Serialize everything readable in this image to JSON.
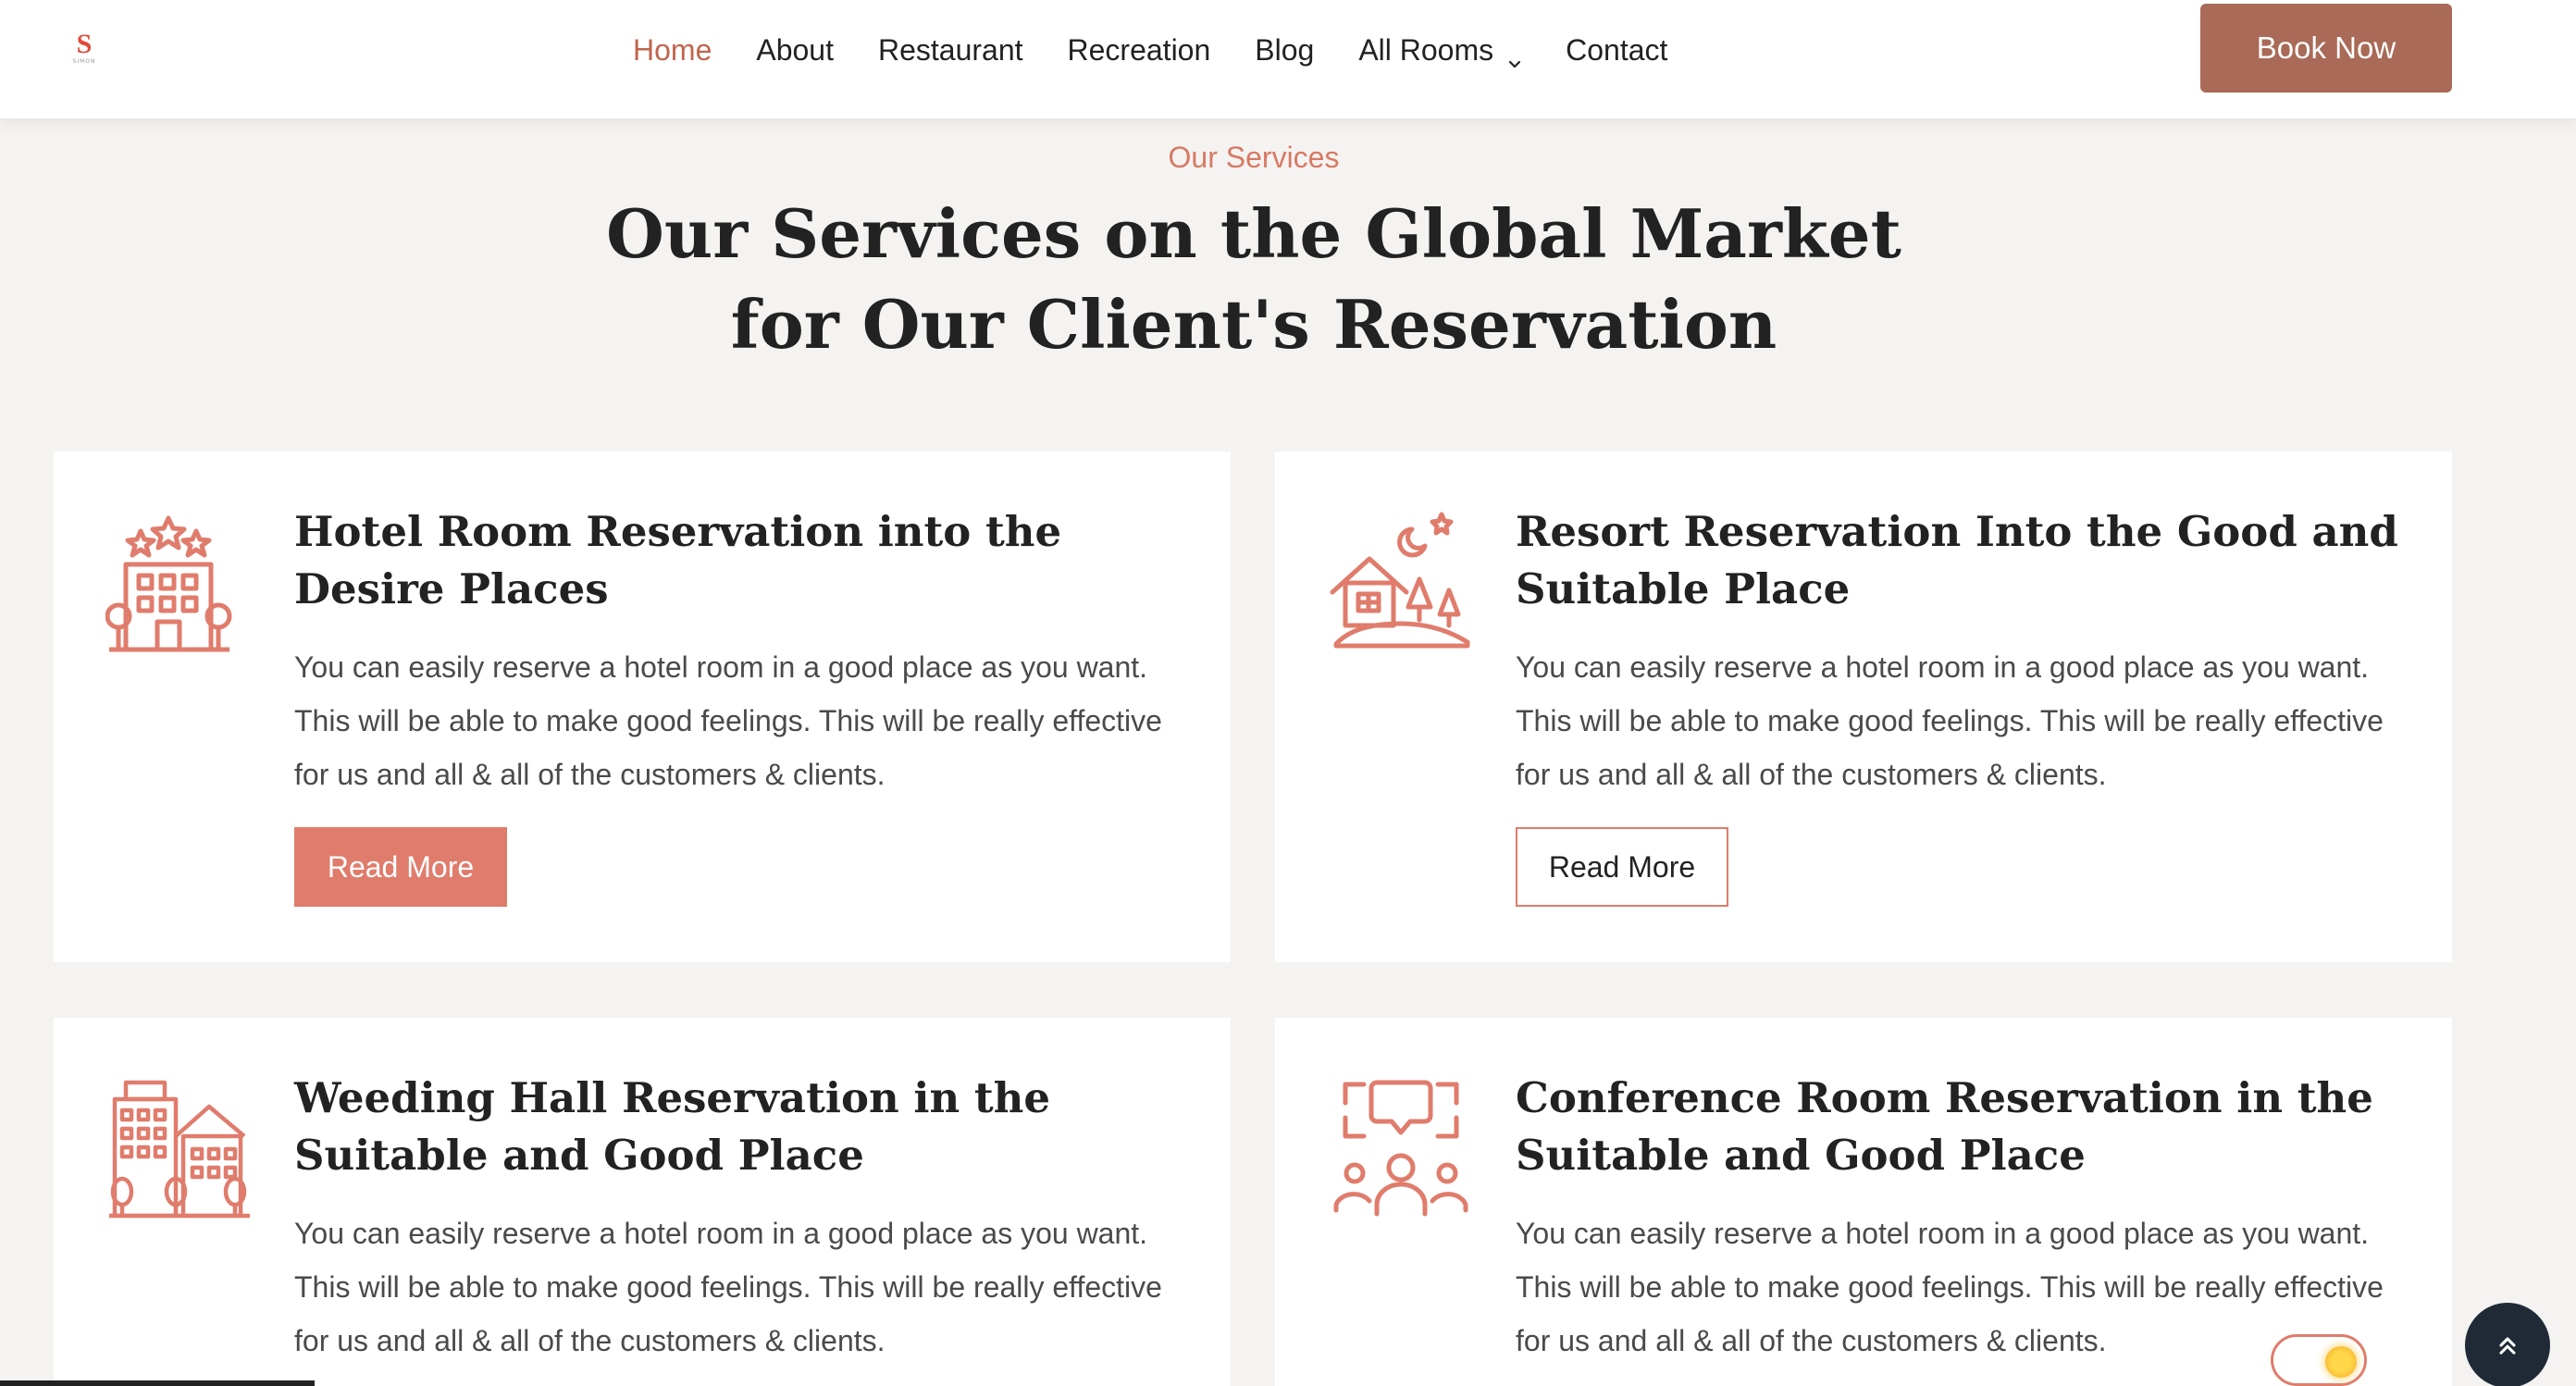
{
  "header": {
    "logo_text": "S",
    "logo_sub": "SIMON",
    "nav": [
      {
        "label": "Home"
      },
      {
        "label": "About"
      },
      {
        "label": "Restaurant"
      },
      {
        "label": "Recreation"
      },
      {
        "label": "Blog"
      },
      {
        "label": "All Rooms"
      },
      {
        "label": "Contact"
      }
    ],
    "book_label": "Book Now"
  },
  "section": {
    "eyebrow": "Our Services",
    "title_line1": "Our Services on the Global Market",
    "title_line2": "for Our Client's Reservation"
  },
  "cards": [
    {
      "title": "Hotel Room Reservation into the Desire Places",
      "text": "You can easily reserve a hotel room in a good place as you want. This will be able to make good feelings. This will be really effective for us and all & all of the customers & clients.",
      "button": "Read More",
      "icon": "hotel-icon"
    },
    {
      "title": "Resort Reservation Into the Good and Suitable Place",
      "text": "You can easily reserve a hotel room in a good place as you want. This will be able to make good feelings. This will be really effective for us and all & all of the customers & clients.",
      "button": "Read More",
      "icon": "resort-icon"
    },
    {
      "title": "Weeding Hall Reservation in the Suitable and Good Place",
      "text": "You can easily reserve a hotel room in a good place as you want. This will be able to make good feelings. This will be really effective for us and all & all of the customers & clients.",
      "icon": "wedding-hall-icon"
    },
    {
      "title": "Conference Room Reservation in the Suitable and Good Place",
      "text": "You can easily reserve a hotel room in a good place as you want. This will be able to make good feelings. This will be really effective for us and all & all of the customers & clients.",
      "icon": "conference-icon"
    }
  ],
  "widgets": {
    "scroll_top_glyph": "⌃",
    "scroll_top_icon": "double-chevron-up-icon",
    "theme_toggle_icon": "sun-icon"
  },
  "colors": {
    "accent": "#e07c6c",
    "brand_button": "#a96a57",
    "nav_active": "#c0654e",
    "background": "#f4f3f1"
  }
}
